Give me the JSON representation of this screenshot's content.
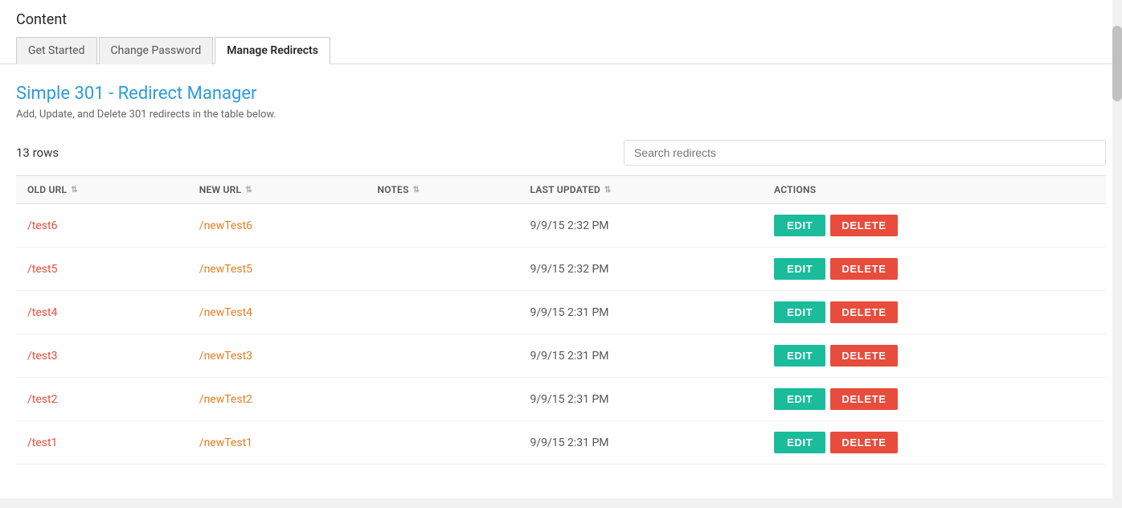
{
  "app": {
    "title": "Content"
  },
  "tabs": [
    {
      "id": "get-started",
      "label": "Get Started",
      "active": false
    },
    {
      "id": "change-password",
      "label": "Change Password",
      "active": false
    },
    {
      "id": "manage-redirects",
      "label": "Manage Redirects",
      "active": true
    }
  ],
  "page": {
    "title": "Simple 301 - Redirect Manager",
    "subtitle": "Add, Update, and Delete 301 redirects in the table below.",
    "rows_count": "13 rows",
    "search_placeholder": "Search redirects"
  },
  "table": {
    "columns": [
      {
        "id": "old-url",
        "label": "OLD URL",
        "sortable": true
      },
      {
        "id": "new-url",
        "label": "NEW URL",
        "sortable": true
      },
      {
        "id": "notes",
        "label": "NOTES",
        "sortable": true
      },
      {
        "id": "last-updated",
        "label": "LAST UPDATED",
        "sortable": true
      },
      {
        "id": "actions",
        "label": "ACTIONS",
        "sortable": false
      }
    ],
    "rows": [
      {
        "old_url": "/test6",
        "new_url": "/newTest6",
        "notes": "",
        "last_updated": "9/9/15 2:32 PM"
      },
      {
        "old_url": "/test5",
        "new_url": "/newTest5",
        "notes": "",
        "last_updated": "9/9/15 2:32 PM"
      },
      {
        "old_url": "/test4",
        "new_url": "/newTest4",
        "notes": "",
        "last_updated": "9/9/15 2:31 PM"
      },
      {
        "old_url": "/test3",
        "new_url": "/newTest3",
        "notes": "",
        "last_updated": "9/9/15 2:31 PM"
      },
      {
        "old_url": "/test2",
        "new_url": "/newTest2",
        "notes": "",
        "last_updated": "9/9/15 2:31 PM"
      },
      {
        "old_url": "/test1",
        "new_url": "/newTest1",
        "notes": "",
        "last_updated": "9/9/15 2:31 PM"
      }
    ]
  },
  "buttons": {
    "edit_label": "EDIT",
    "delete_label": "DELETE"
  }
}
